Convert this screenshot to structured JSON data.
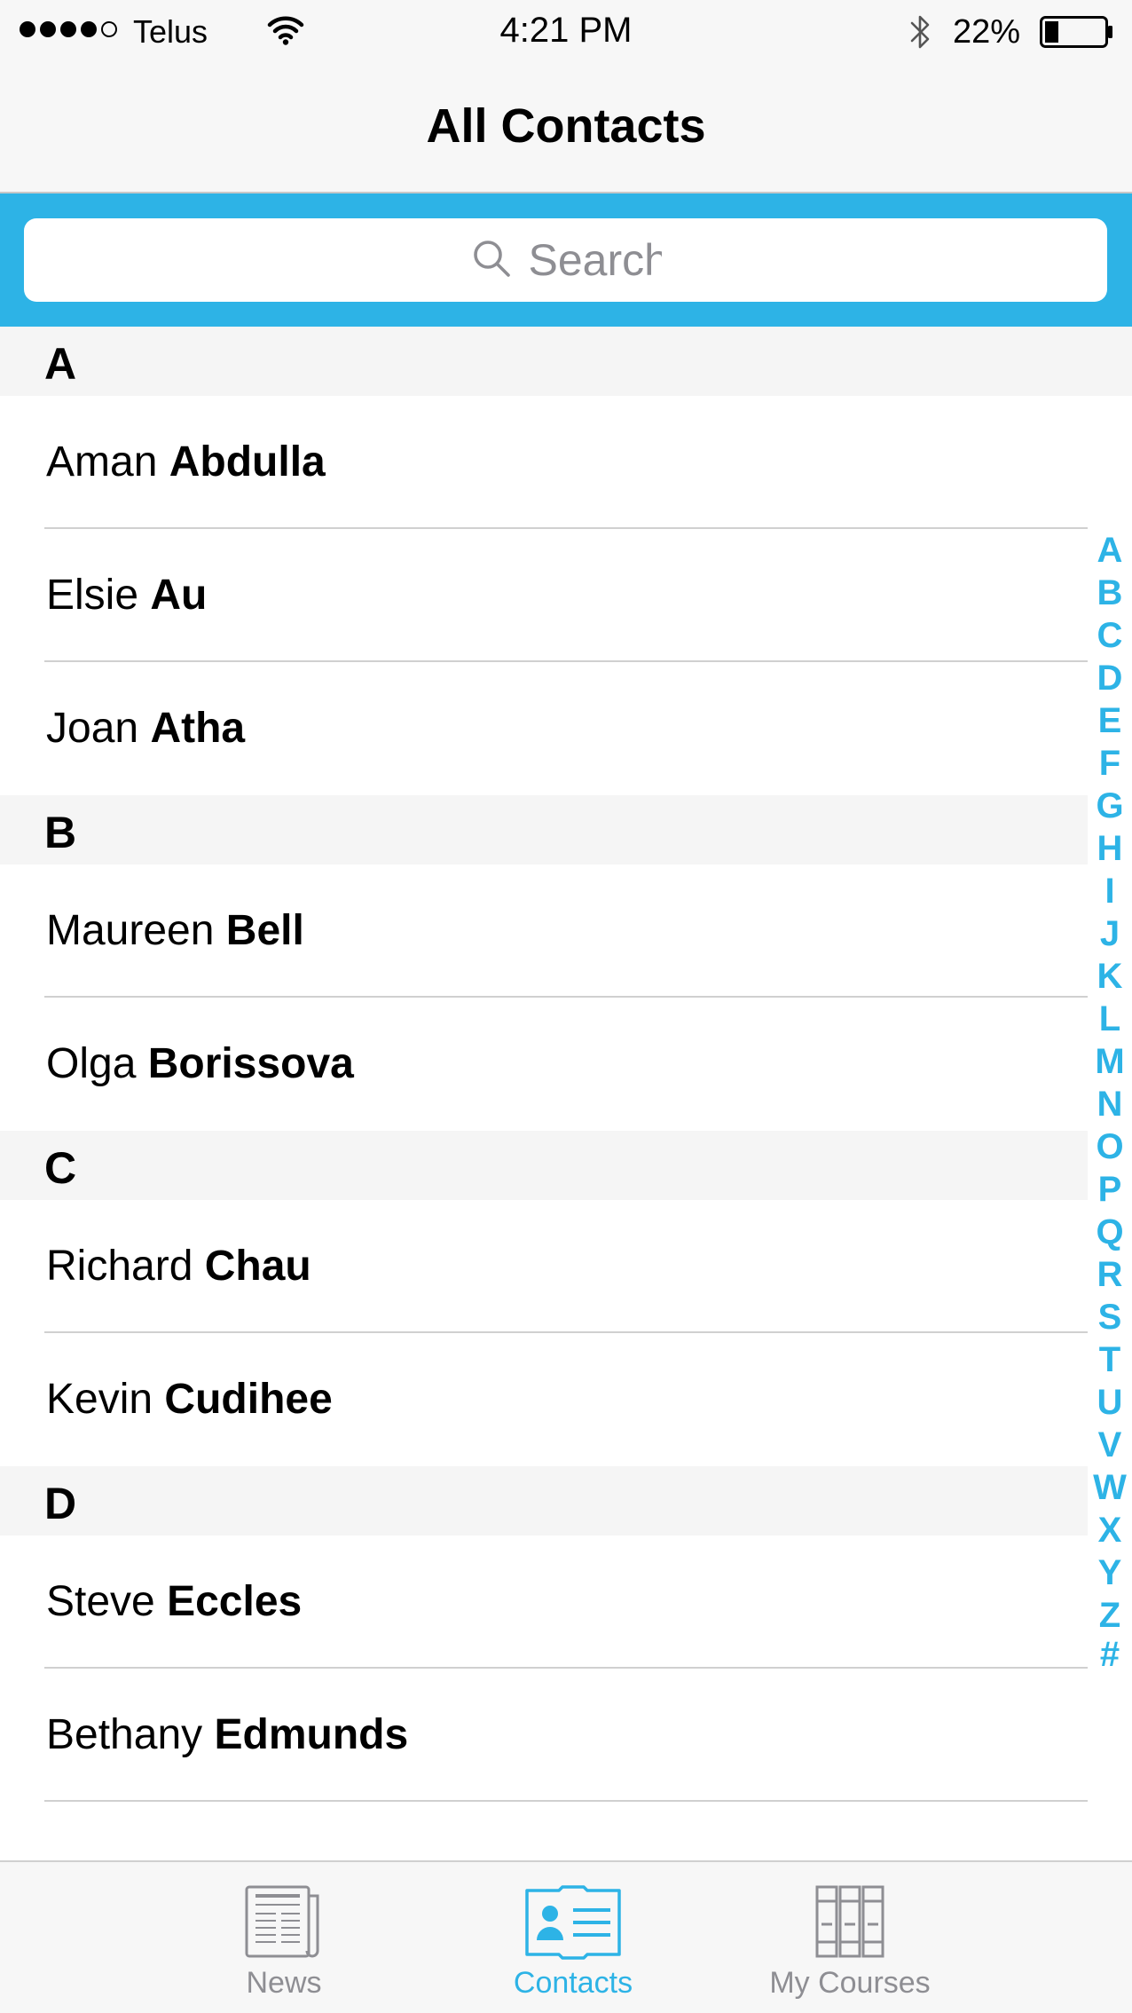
{
  "status_bar": {
    "carrier": "Telus",
    "time": "4:21 PM",
    "battery_percent": "22%",
    "battery_level": 0.22,
    "signal_bars_filled": 4,
    "signal_bars_total": 5
  },
  "nav": {
    "title": "All Contacts"
  },
  "search": {
    "placeholder": "Search",
    "value": ""
  },
  "colors": {
    "accent": "#2db3e6",
    "section_bg": "#f5f5f5",
    "separator": "#d0d0d0"
  },
  "sections": [
    {
      "letter": "A",
      "contacts": [
        {
          "first": "Aman",
          "last": "Abdulla"
        },
        {
          "first": "Elsie",
          "last": "Au"
        },
        {
          "first": "Joan",
          "last": "Atha"
        }
      ]
    },
    {
      "letter": "B",
      "contacts": [
        {
          "first": "Maureen",
          "last": "Bell"
        },
        {
          "first": "Olga",
          "last": "Borissova"
        }
      ]
    },
    {
      "letter": "C",
      "contacts": [
        {
          "first": "Richard",
          "last": "Chau"
        },
        {
          "first": "Kevin",
          "last": "Cudihee"
        }
      ]
    },
    {
      "letter": "D",
      "contacts": [
        {
          "first": "Steve",
          "last": "Eccles"
        },
        {
          "first": "Bethany",
          "last": "Edmunds"
        }
      ]
    }
  ],
  "index_letters": [
    "A",
    "B",
    "C",
    "D",
    "E",
    "F",
    "G",
    "H",
    "I",
    "J",
    "K",
    "L",
    "M",
    "N",
    "O",
    "P",
    "Q",
    "R",
    "S",
    "T",
    "U",
    "V",
    "W",
    "X",
    "Y",
    "Z",
    "#"
  ],
  "tabs": [
    {
      "label": "News",
      "icon": "newspaper-icon",
      "active": false
    },
    {
      "label": "Contacts",
      "icon": "contact-card-icon",
      "active": true
    },
    {
      "label": "My Courses",
      "icon": "books-icon",
      "active": false
    }
  ]
}
